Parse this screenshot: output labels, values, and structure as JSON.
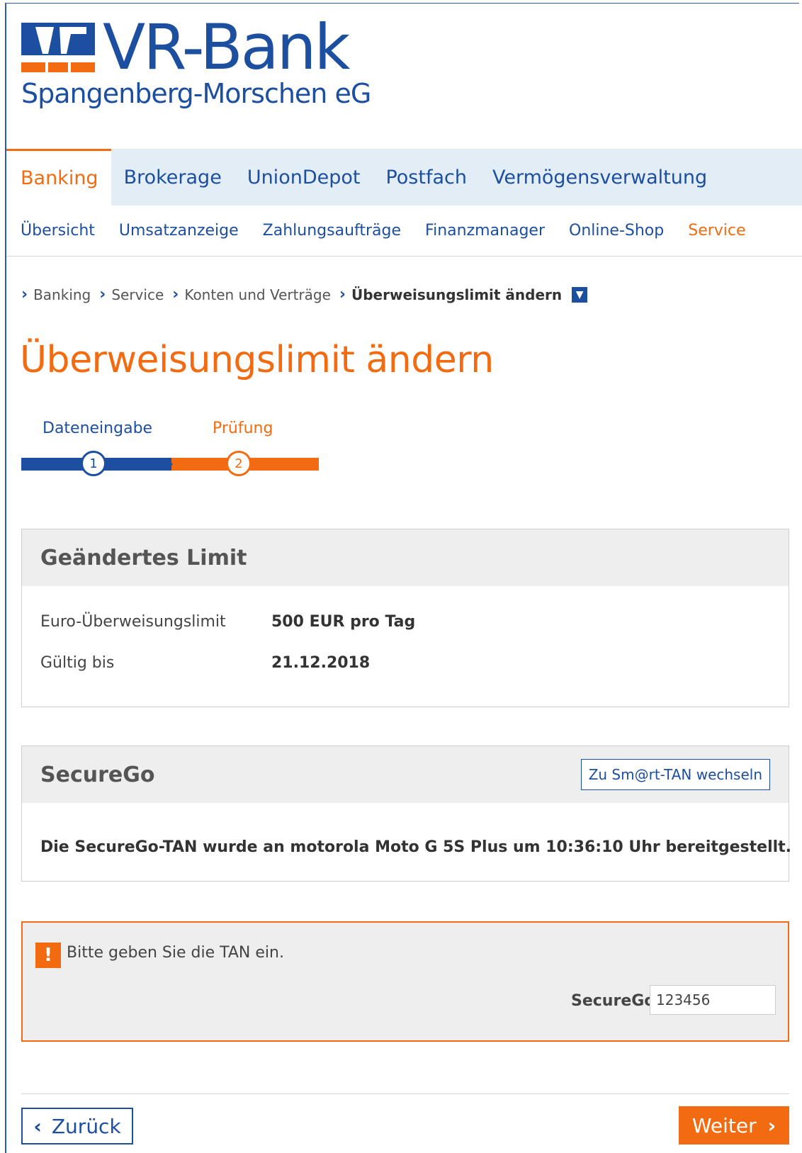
{
  "brand": {
    "name": "VR-Bank",
    "subtitle": "Spangenberg-Morschen eG",
    "colors": {
      "blue": "#1d4fa0",
      "orange": "#f26b10"
    }
  },
  "main_nav": [
    {
      "label": "Banking",
      "active": true
    },
    {
      "label": "Brokerage"
    },
    {
      "label": "UnionDepot"
    },
    {
      "label": "Postfach"
    },
    {
      "label": "Vermögensverwaltung"
    }
  ],
  "sub_nav": [
    {
      "label": "Übersicht"
    },
    {
      "label": "Umsatzanzeige"
    },
    {
      "label": "Zahlungsaufträge"
    },
    {
      "label": "Finanzmanager"
    },
    {
      "label": "Online-Shop"
    },
    {
      "label": "Service",
      "active": true
    }
  ],
  "breadcrumb": [
    "Banking",
    "Service",
    "Konten und Verträge",
    "Überweisungslimit ändern"
  ],
  "page_title": "Überweisungslimit ändern",
  "stepper": {
    "steps": [
      {
        "label": "Dateneingabe",
        "number": "1"
      },
      {
        "label": "Prüfung",
        "number": "2",
        "current": true
      }
    ]
  },
  "limit_panel": {
    "title": "Geändertes Limit",
    "rows": [
      {
        "label": "Euro-Überweisungslimit",
        "value": "500 EUR pro Tag"
      },
      {
        "label": "Gültig bis",
        "value": "21.12.2018"
      }
    ]
  },
  "securego_panel": {
    "title": "SecureGo",
    "switch_button": "Zu Sm@rt-TAN wechseln",
    "message": "Die SecureGo-TAN wurde an motorola Moto G 5S Plus um 10:36:10 Uhr bereitgestellt."
  },
  "tan_box": {
    "warning_icon": "exclamation-icon",
    "message": "Bitte geben Sie die TAN ein.",
    "field_label": "SecureGo",
    "field_value": "123456"
  },
  "buttons": {
    "back": "Zurück",
    "next": "Weiter"
  }
}
